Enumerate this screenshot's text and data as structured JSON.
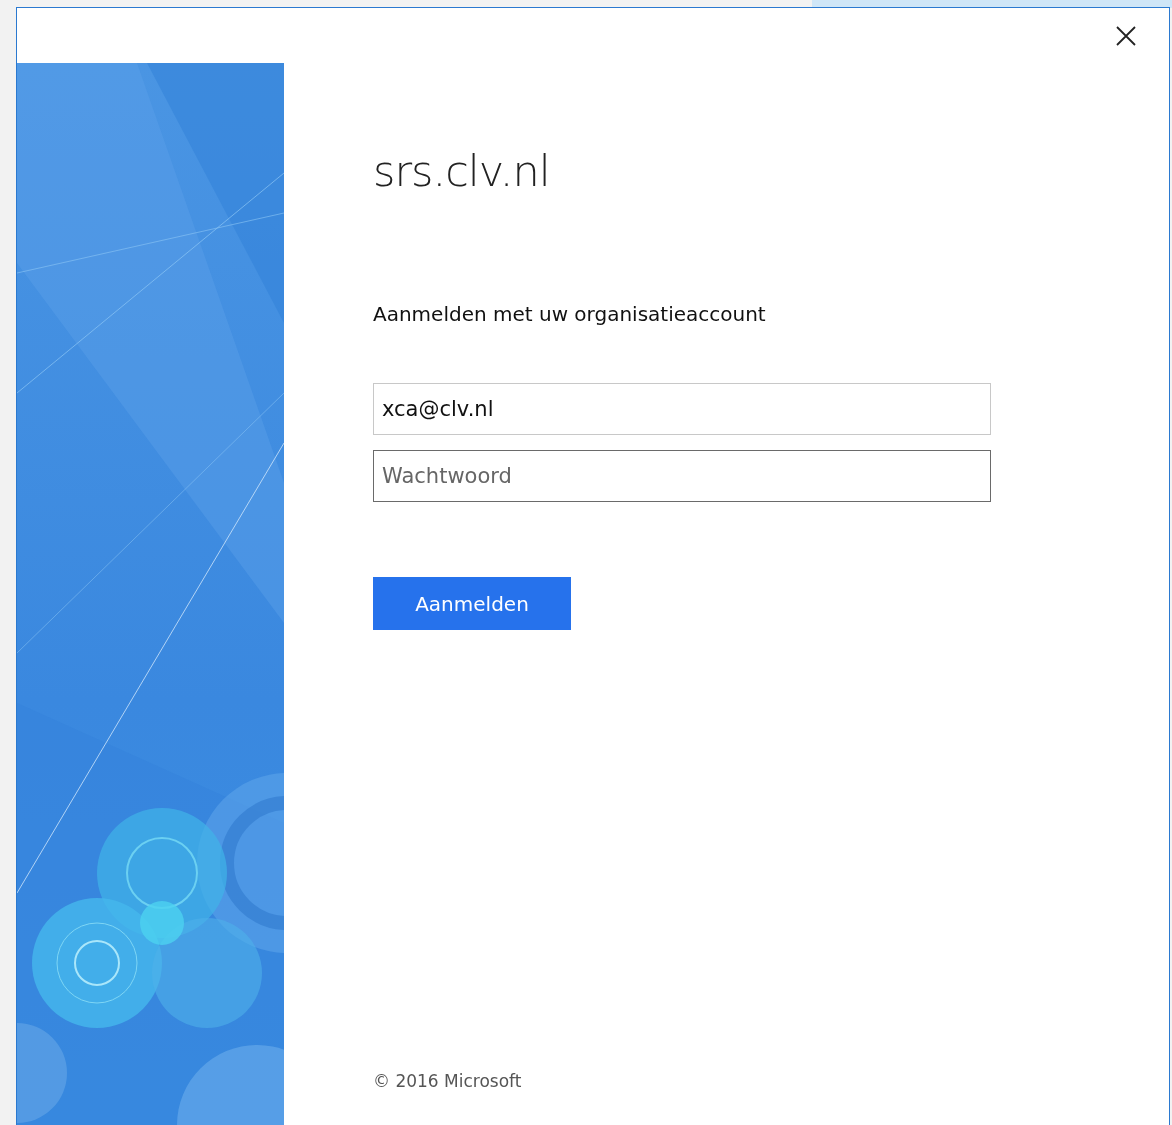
{
  "dialog": {
    "site_title": "srs.clv.nl",
    "subtitle": "Aanmelden met uw organisatieaccount",
    "fields": [
      {
        "kind": "text",
        "value": "xca@clv.nl",
        "focused": false
      },
      {
        "kind": "password",
        "placeholder": "Wachtwoord",
        "focused": true
      }
    ],
    "button": "Aanmelden",
    "footer": "© 2016 Microsoft"
  }
}
